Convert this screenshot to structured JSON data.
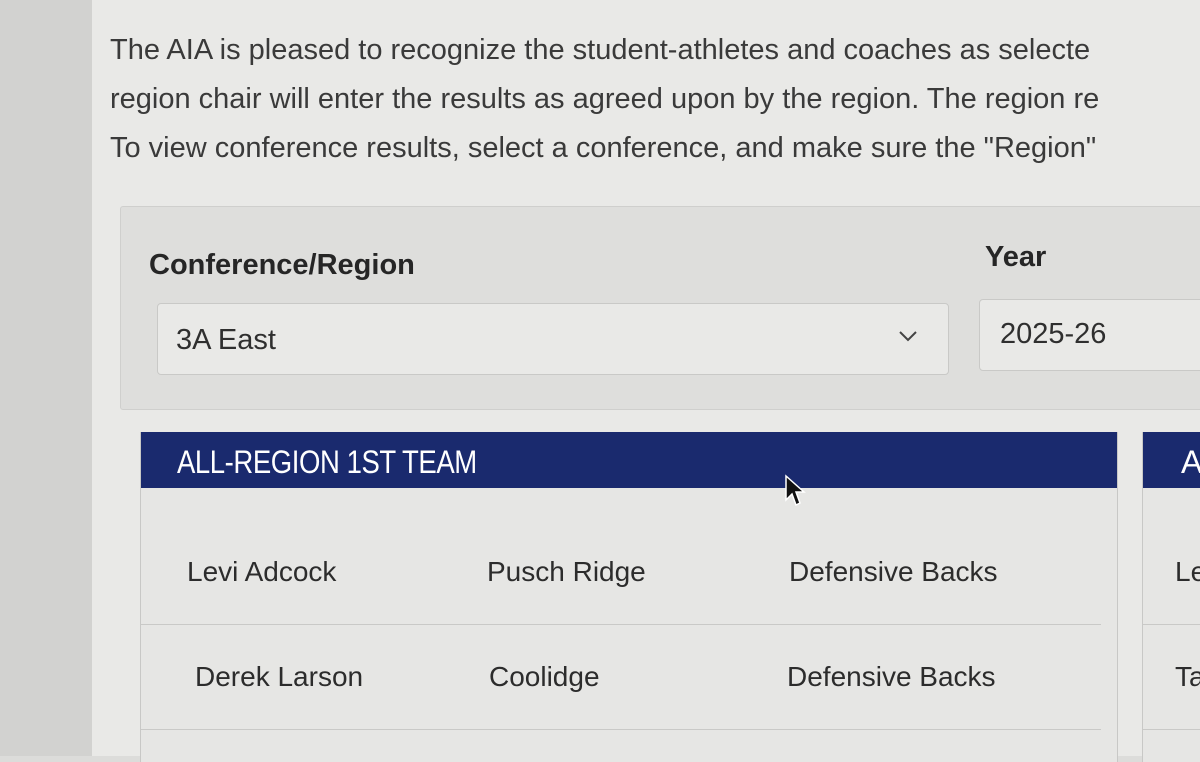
{
  "intro": {
    "line1": "The AIA is pleased to recognize the student-athletes and coaches as selecte",
    "line2": "region chair will enter the results as agreed upon by the region. The region re",
    "line3": "To view conference results, select a conference, and make sure the \"Region\""
  },
  "filters": {
    "conference_label": "Conference/Region",
    "conference_value": "3A East",
    "year_label": "Year",
    "year_value": "2025-26"
  },
  "team": {
    "title": "ALL-REGION 1ST TEAM",
    "rows": [
      {
        "name": "Levi Adcock",
        "school": "Pusch Ridge",
        "position": "Defensive Backs"
      },
      {
        "name": "Derek Larson",
        "school": "Coolidge",
        "position": "Defensive Backs"
      }
    ]
  },
  "second_team": {
    "title_partial": "A",
    "rows": [
      {
        "name_partial": "Le"
      },
      {
        "name_partial": "Ta"
      }
    ]
  },
  "icons": {
    "dropdown": "chevron-down-icon",
    "cursor": "mouse-pointer-icon"
  },
  "colors": {
    "header_bg": "#1a2a6e",
    "header_text": "#ffffff"
  }
}
